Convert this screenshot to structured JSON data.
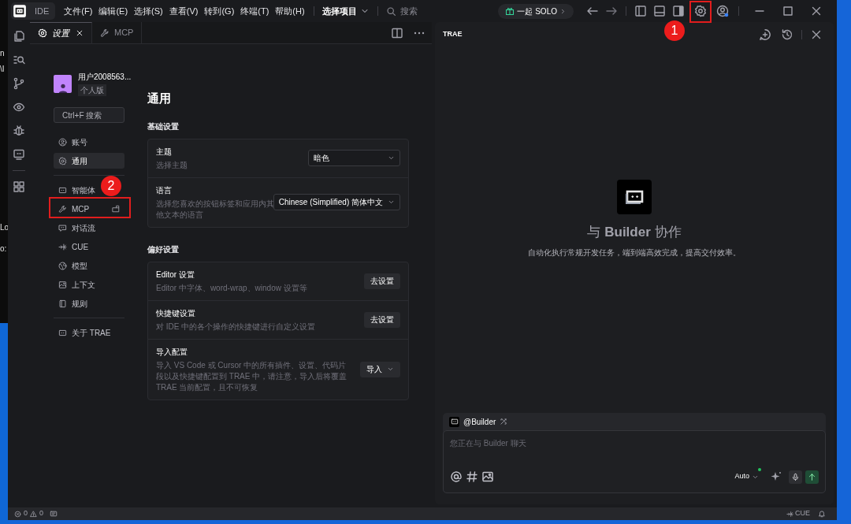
{
  "desktop": {
    "fragments": [
      "n",
      "\\I",
      "Lo",
      "o:"
    ]
  },
  "titlebar": {
    "app_label": "IDE",
    "menu": [
      "文件(F)",
      "编辑(E)",
      "选择(S)",
      "查看(V)",
      "转到(G)",
      "终端(T)",
      "帮助(H)"
    ],
    "project": "选择项目",
    "search": {
      "placeholder": "搜索"
    },
    "solo": "一起 SOLO",
    "settings_marker": "1"
  },
  "tabs": [
    {
      "label": "设置",
      "selected": true,
      "closable": true
    },
    {
      "label": "MCP",
      "selected": false,
      "closable": false
    }
  ],
  "settings": {
    "user": {
      "name": "用户2008563...",
      "plan": "个人版"
    },
    "search": {
      "placeholder": "Ctrl+F 搜索"
    },
    "nav_groups": [
      {
        "items": [
          {
            "label": "账号",
            "selected": false
          },
          {
            "label": "通用",
            "selected": true
          }
        ]
      },
      {
        "items": [
          {
            "label": "智能体",
            "selected": false
          },
          {
            "label": "MCP",
            "selected": false,
            "external": true,
            "marker": "2"
          },
          {
            "label": "对话流",
            "selected": false
          },
          {
            "label": "CUE",
            "selected": false
          },
          {
            "label": "模型",
            "selected": false
          },
          {
            "label": "上下文",
            "selected": false
          },
          {
            "label": "规则",
            "selected": false
          }
        ]
      },
      {
        "items": [
          {
            "label": "关于 TRAE",
            "selected": false
          }
        ]
      }
    ],
    "title": "通用",
    "sections": [
      {
        "heading": "基础设置",
        "rows": [
          {
            "kind": "select",
            "title": "主题",
            "description": "选择主题",
            "value": "暗色"
          },
          {
            "kind": "select",
            "title": "语言",
            "description": "选择您喜欢的按钮标签和应用内其他文本的语言",
            "value": "Chinese (Simplified) 简体中文"
          }
        ]
      },
      {
        "heading": "偏好设置",
        "rows": [
          {
            "kind": "button",
            "title": "Editor 设置",
            "description": "Editor 中字体、word-wrap、window 设置等",
            "value": "去设置"
          },
          {
            "kind": "button",
            "title": "快捷键设置",
            "description": "对 IDE 中的各个操作的快捷键进行自定义设置",
            "value": "去设置"
          },
          {
            "kind": "menu",
            "title": "导入配置",
            "description": "导入 VS Code 或 Cursor 中的所有插件、设置、代码片段以及快捷键配置到 TRAE 中，请注意，导入后将覆盖 TRAE 当前配置，且不可恢复",
            "value": "导入"
          }
        ]
      }
    ]
  },
  "chat": {
    "title": "TRAE",
    "heading": "与 **Builder** 协作",
    "subtitle": "自动化执行常规开发任务，端到端高效完成，提高交付效率。",
    "agent": "@Builder",
    "input": {
      "placeholder": "您正在与 Builder 聊天"
    },
    "model": "Auto"
  },
  "status_bar": {
    "errors": "0",
    "warnings": "0",
    "cue": "CUE"
  }
}
